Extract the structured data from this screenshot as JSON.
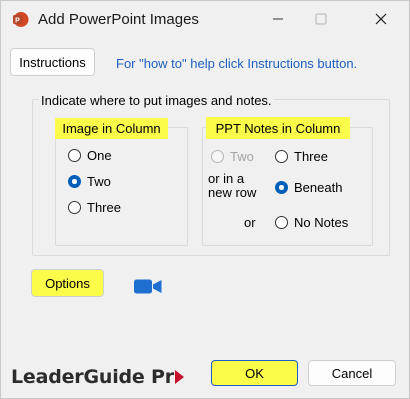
{
  "window": {
    "title": "Add PowerPoint Images"
  },
  "toolbar": {
    "instructions_label": "Instructions",
    "help_text": "For \"how to\" help click Instructions button."
  },
  "placement": {
    "label": "Indicate where to put images and notes.",
    "image_column": {
      "title": "Image in Column",
      "options": [
        "One",
        "Two",
        "Three"
      ],
      "selected": "Two"
    },
    "ppt_notes_column": {
      "title": "PPT Notes in Column",
      "option_two": "Two",
      "option_three": "Three",
      "or_new_row": "or in a new row",
      "option_beneath": "Beneath",
      "or_text": "or",
      "option_no_notes": "No Notes",
      "selected": "Beneath"
    }
  },
  "options_label": "Options",
  "brand": {
    "name": "LeaderGuide Pr"
  },
  "footer": {
    "ok_label": "OK",
    "cancel_label": "Cancel"
  },
  "colors": {
    "highlight": "#fbfb4a",
    "accent": "#005fb8",
    "link": "#1f5fbf",
    "brand_red": "#c8102e"
  }
}
